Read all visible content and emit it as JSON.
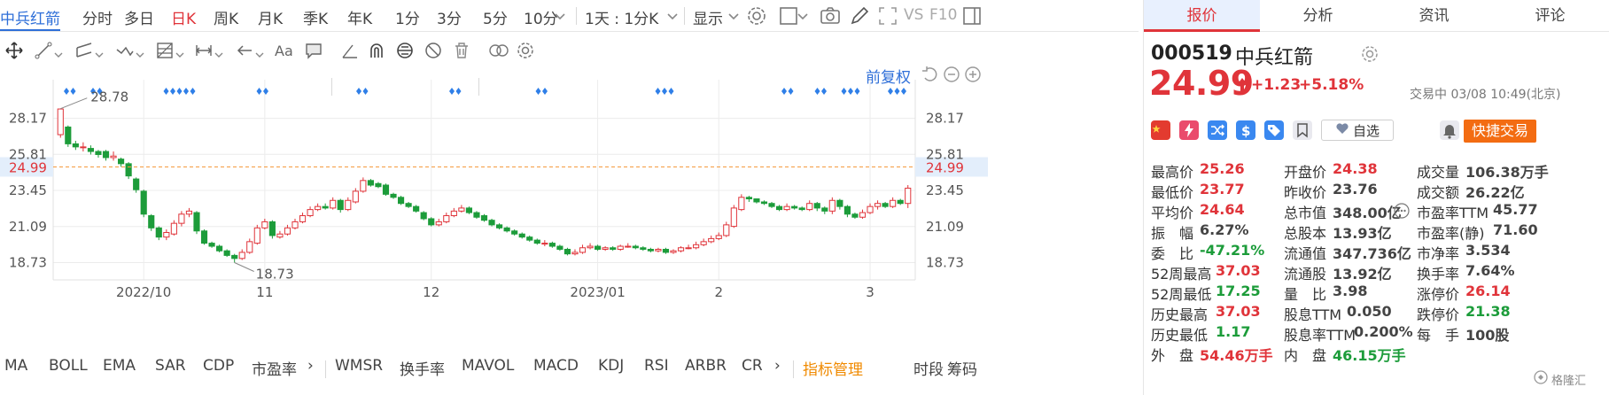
{
  "toolbar": {
    "symbol": "中兵红箭",
    "periods": [
      "分时",
      "多日",
      "日K",
      "周K",
      "月K",
      "季K",
      "年K",
      "1分",
      "3分",
      "5分",
      "10分"
    ],
    "active_period": "日K",
    "range": "1天 : 1分K",
    "display": "显示",
    "vs": "VS",
    "f10": "F10"
  },
  "chart_controls": {
    "adjust": "前复权"
  },
  "chart_data": {
    "type": "candlestick",
    "dates": [
      "2022-09-16",
      "2022-09-19",
      "2022-09-20",
      "2022-09-21",
      "2022-09-22",
      "2022-09-23",
      "2022-09-26",
      "2022-09-27",
      "2022-09-28",
      "2022-09-29",
      "2022-09-30",
      "2022-10-10",
      "2022-10-11",
      "2022-10-12",
      "2022-10-13",
      "2022-10-14",
      "2022-10-17",
      "2022-10-18",
      "2022-10-19",
      "2022-10-20",
      "2022-10-21",
      "2022-10-24",
      "2022-10-25",
      "2022-10-26",
      "2022-10-27",
      "2022-10-28",
      "2022-10-31",
      "2022-11-01",
      "2022-11-02",
      "2022-11-03",
      "2022-11-04",
      "2022-11-07",
      "2022-11-08",
      "2022-11-09",
      "2022-11-10",
      "2022-11-11",
      "2022-11-14",
      "2022-11-15",
      "2022-11-16",
      "2022-11-17",
      "2022-11-18",
      "2022-11-21",
      "2022-11-22",
      "2022-11-23",
      "2022-11-24",
      "2022-11-25",
      "2022-11-28",
      "2022-11-29",
      "2022-11-30",
      "2022-12-01",
      "2022-12-02",
      "2022-12-05",
      "2022-12-06",
      "2022-12-07",
      "2022-12-08",
      "2022-12-09",
      "2022-12-12",
      "2022-12-13",
      "2022-12-14",
      "2022-12-15",
      "2022-12-16",
      "2022-12-19",
      "2022-12-20",
      "2022-12-21",
      "2022-12-22",
      "2022-12-23",
      "2022-12-26",
      "2022-12-27",
      "2022-12-28",
      "2022-12-29",
      "2022-12-30",
      "2023-01-03",
      "2023-01-04",
      "2023-01-05",
      "2023-01-06",
      "2023-01-09",
      "2023-01-10",
      "2023-01-11",
      "2023-01-12",
      "2023-01-13",
      "2023-01-16",
      "2023-01-17",
      "2023-01-18",
      "2023-01-19",
      "2023-01-20",
      "2023-01-30",
      "2023-01-31",
      "2023-02-01",
      "2023-02-02",
      "2023-02-03",
      "2023-02-06",
      "2023-02-07",
      "2023-02-08",
      "2023-02-09",
      "2023-02-10",
      "2023-02-13",
      "2023-02-14",
      "2023-02-15",
      "2023-02-16",
      "2023-02-17",
      "2023-02-20",
      "2023-02-21",
      "2023-02-22",
      "2023-02-23",
      "2023-02-24",
      "2023-02-27",
      "2023-02-28",
      "2023-03-01",
      "2023-03-02",
      "2023-03-03",
      "2023-03-06",
      "2023-03-07",
      "2023-03-08"
    ],
    "open": [
      27.1,
      27.6,
      26.5,
      26.3,
      26.2,
      26.0,
      26.0,
      25.6,
      25.5,
      25.2,
      24.2,
      23.4,
      21.8,
      21.0,
      20.4,
      20.6,
      21.3,
      21.9,
      22.0,
      20.8,
      20.0,
      19.8,
      19.5,
      19.2,
      19.0,
      19.4,
      20.0,
      21.0,
      21.4,
      20.4,
      20.6,
      21.0,
      21.4,
      21.8,
      22.2,
      22.4,
      22.3,
      22.8,
      22.2,
      22.7,
      23.4,
      24.1,
      23.9,
      23.8,
      23.2,
      23.0,
      22.6,
      22.4,
      22.0,
      21.6,
      21.2,
      21.4,
      21.8,
      22.1,
      22.3,
      22.0,
      21.8,
      21.5,
      21.2,
      21.0,
      20.8,
      20.6,
      20.4,
      20.2,
      20.0,
      20.0,
      19.8,
      19.6,
      19.3,
      19.4,
      19.7,
      19.8,
      19.6,
      19.7,
      19.6,
      19.8,
      19.8,
      19.7,
      19.6,
      19.5,
      19.6,
      19.4,
      19.5,
      19.7,
      19.7,
      19.9,
      20.1,
      20.3,
      20.5,
      21.1,
      22.2,
      23.0,
      22.9,
      22.7,
      22.6,
      22.4,
      22.2,
      22.4,
      22.3,
      22.2,
      22.6,
      22.3,
      22.1,
      22.8,
      22.4,
      21.9,
      21.7,
      22.0,
      22.4,
      22.6,
      22.4,
      22.8,
      22.6,
      22.4,
      23.6,
      23.8,
      24.7
    ],
    "close": [
      28.78,
      26.5,
      26.3,
      26.3,
      26.0,
      25.8,
      25.6,
      25.7,
      25.2,
      24.4,
      23.5,
      21.9,
      21.0,
      20.4,
      20.7,
      21.3,
      21.9,
      22.1,
      20.8,
      20.0,
      19.8,
      19.5,
      19.2,
      19.0,
      19.4,
      20.1,
      21.0,
      21.4,
      20.5,
      20.6,
      21.0,
      21.4,
      21.8,
      22.2,
      22.4,
      22.3,
      22.8,
      22.2,
      22.8,
      23.4,
      24.1,
      23.8,
      23.7,
      23.2,
      23.0,
      22.6,
      22.4,
      22.1,
      21.6,
      21.2,
      21.4,
      21.8,
      22.1,
      22.3,
      22.0,
      21.7,
      21.5,
      21.2,
      21.0,
      20.8,
      20.6,
      20.4,
      20.2,
      20.0,
      20.0,
      19.8,
      19.6,
      19.3,
      19.4,
      19.7,
      19.8,
      19.6,
      19.7,
      19.6,
      19.8,
      19.8,
      19.7,
      19.6,
      19.5,
      19.6,
      19.4,
      19.5,
      19.7,
      19.7,
      19.9,
      20.1,
      20.3,
      20.5,
      21.2,
      22.3,
      23.0,
      22.9,
      22.7,
      22.6,
      22.4,
      22.2,
      22.4,
      22.3,
      22.2,
      22.6,
      22.3,
      22.1,
      22.8,
      22.4,
      21.9,
      21.7,
      22.0,
      22.4,
      22.6,
      22.4,
      22.8,
      22.6,
      23.6,
      23.8,
      23.76,
      24.5,
      24.99
    ],
    "high": [
      28.8,
      27.7,
      26.7,
      26.6,
      26.4,
      26.1,
      26.1,
      26.0,
      25.6,
      25.3,
      24.3,
      23.5,
      21.9,
      21.1,
      20.9,
      21.5,
      22.1,
      22.3,
      22.1,
      20.9,
      20.1,
      19.9,
      19.6,
      19.3,
      19.6,
      20.3,
      21.2,
      21.6,
      21.5,
      20.8,
      21.2,
      21.6,
      22.0,
      22.4,
      22.6,
      22.6,
      23.0,
      22.9,
      23.0,
      23.6,
      24.3,
      24.2,
      24.0,
      23.9,
      23.3,
      23.1,
      22.7,
      22.5,
      22.1,
      21.7,
      21.6,
      22.0,
      22.3,
      22.5,
      22.4,
      22.1,
      21.9,
      21.6,
      21.3,
      21.1,
      20.9,
      20.7,
      20.5,
      20.3,
      20.2,
      20.1,
      19.9,
      19.7,
      19.6,
      19.9,
      20.0,
      19.9,
      19.8,
      19.8,
      19.9,
      20.0,
      19.9,
      19.8,
      19.7,
      19.7,
      19.7,
      19.6,
      19.8,
      19.9,
      20.1,
      20.3,
      20.5,
      20.7,
      21.4,
      22.5,
      23.2,
      23.1,
      22.9,
      22.8,
      22.7,
      22.5,
      22.6,
      22.5,
      22.4,
      22.8,
      22.7,
      22.4,
      23.0,
      22.9,
      22.5,
      22.0,
      22.2,
      22.6,
      22.8,
      22.7,
      23.0,
      22.9,
      23.8,
      24.1,
      24.0,
      24.7,
      25.26
    ],
    "low": [
      26.9,
      26.3,
      26.1,
      26.0,
      25.8,
      25.6,
      25.4,
      25.4,
      25.0,
      24.2,
      23.3,
      21.7,
      20.8,
      20.2,
      20.2,
      20.5,
      21.1,
      21.7,
      20.6,
      19.9,
      19.7,
      19.4,
      19.1,
      18.73,
      18.9,
      19.3,
      19.9,
      20.9,
      20.3,
      20.3,
      20.5,
      20.9,
      21.3,
      21.7,
      22.1,
      22.2,
      22.2,
      22.0,
      22.1,
      22.6,
      23.3,
      23.7,
      23.6,
      23.1,
      22.9,
      22.5,
      22.3,
      22.0,
      21.5,
      21.1,
      21.1,
      21.3,
      21.7,
      22.0,
      21.9,
      21.6,
      21.4,
      21.1,
      20.9,
      20.7,
      20.5,
      20.3,
      20.1,
      19.9,
      19.8,
      19.7,
      19.5,
      19.2,
      19.2,
      19.3,
      19.6,
      19.5,
      19.5,
      19.5,
      19.5,
      19.7,
      19.6,
      19.5,
      19.4,
      19.4,
      19.3,
      19.3,
      19.4,
      19.6,
      19.6,
      19.8,
      20.0,
      20.2,
      20.4,
      21.0,
      22.1,
      22.7,
      22.6,
      22.5,
      22.3,
      22.1,
      22.1,
      22.2,
      22.1,
      22.1,
      22.1,
      21.9,
      21.9,
      22.2,
      21.7,
      21.6,
      21.6,
      21.9,
      22.2,
      22.3,
      22.3,
      22.5,
      22.3,
      22.3,
      23.5,
      23.6,
      24.2
    ],
    "y_ticks": [
      28.17,
      25.81,
      23.45,
      21.09,
      18.73
    ],
    "ylim": [
      17.6,
      30.0
    ],
    "x_ticks": [
      {
        "date": "2022-10-10",
        "label": "2022/10"
      },
      {
        "date": "2022-11-01",
        "label": "11"
      },
      {
        "date": "2022-12-01",
        "label": "12"
      },
      {
        "date": "2023-01-03",
        "label": "2023/01"
      },
      {
        "date": "2023-02-01",
        "label": "2"
      },
      {
        "date": "2023-03-01",
        "label": "3"
      }
    ],
    "current_price": 24.99,
    "annotations": {
      "max": "28.78",
      "min": "18.73"
    },
    "signal_groups": [
      [
        2,
        3
      ],
      [
        6,
        7
      ],
      [
        17,
        18,
        19,
        20,
        21
      ],
      [
        31,
        32
      ],
      [
        46,
        47
      ],
      [
        60,
        61
      ],
      [
        73,
        74
      ],
      [
        91,
        92,
        93
      ],
      [
        110,
        111
      ],
      [
        115,
        116
      ],
      [
        119,
        120,
        121
      ],
      [
        126,
        127,
        128
      ]
    ]
  },
  "indicators": [
    "MA",
    "BOLL",
    "EMA",
    "SAR",
    "CDP",
    "市盈率",
    "WMSR",
    "换手率",
    "MAVOL",
    "MACD",
    "KDJ",
    "RSI",
    "ARBR",
    "CR"
  ],
  "indicator_manage": "指标管理",
  "time_tabs": [
    "时段",
    "筹码"
  ],
  "quote": {
    "tabs": [
      "报价",
      "分析",
      "资讯",
      "评论"
    ],
    "code": "000519",
    "name": "中兵红箭",
    "price": "24.99",
    "change": "+1.23",
    "change_pct": "+5.18%",
    "status": "交易中 03/08 10:49(北京)",
    "watch": "自选",
    "trade_btn": "快捷交易",
    "fields": [
      {
        "label": "最高价",
        "value": "25.26",
        "color": "up"
      },
      {
        "label": "开盘价",
        "value": "24.38",
        "color": "up"
      },
      {
        "label": "成交量",
        "value": "106.38万手",
        "color": "ink"
      },
      {
        "label": "最低价",
        "value": "23.77",
        "color": "up"
      },
      {
        "label": "昨收价",
        "value": "23.76",
        "color": "ink"
      },
      {
        "label": "成交额",
        "value": "26.22亿",
        "color": "ink"
      },
      {
        "label": "平均价",
        "value": "24.64",
        "color": "up"
      },
      {
        "label": "总市值",
        "value": "348.00亿",
        "color": "ink"
      },
      {
        "label": "市盈率TTM",
        "value": "45.77",
        "color": "ink"
      },
      {
        "label": "振　幅",
        "value": "6.27%",
        "color": "ink"
      },
      {
        "label": "总股本",
        "value": "13.93亿",
        "color": "ink"
      },
      {
        "label": "市盈率(静)",
        "value": "71.60",
        "color": "ink"
      },
      {
        "label": "委　比",
        "value": "-47.21%",
        "color": "dn"
      },
      {
        "label": "流通值",
        "value": "347.736亿",
        "color": "ink"
      },
      {
        "label": "市净率",
        "value": "3.534",
        "color": "ink"
      },
      {
        "label": "52周最高",
        "value": "37.03",
        "color": "up"
      },
      {
        "label": "流通股",
        "value": "13.92亿",
        "color": "ink"
      },
      {
        "label": "换手率",
        "value": "7.64%",
        "color": "ink"
      },
      {
        "label": "52周最低",
        "value": "17.25",
        "color": "dn"
      },
      {
        "label": "量　比",
        "value": "3.98",
        "color": "ink"
      },
      {
        "label": "涨停价",
        "value": "26.14",
        "color": "up"
      },
      {
        "label": "历史最高",
        "value": "37.03",
        "color": "up"
      },
      {
        "label": "股息TTM",
        "value": "0.050",
        "color": "ink"
      },
      {
        "label": "跌停价",
        "value": "21.38",
        "color": "dn"
      },
      {
        "label": "历史最低",
        "value": "1.17",
        "color": "dn"
      },
      {
        "label": "股息率TTM",
        "value": "0.200%",
        "color": "ink"
      },
      {
        "label": "每　手",
        "value": "100股",
        "color": "ink"
      },
      {
        "label": "外　盘",
        "value": "54.46万手",
        "color": "up"
      },
      {
        "label": "内　盘",
        "value": "46.15万手",
        "color": "dn"
      }
    ],
    "watermark": "格隆汇"
  },
  "colors": {
    "up": "#e0343a",
    "down": "#1c9c3a",
    "accent": "#2f6fd8",
    "current_line": "#f59a3e",
    "signal": "#2f7fe8",
    "trade": "#f36c12"
  }
}
